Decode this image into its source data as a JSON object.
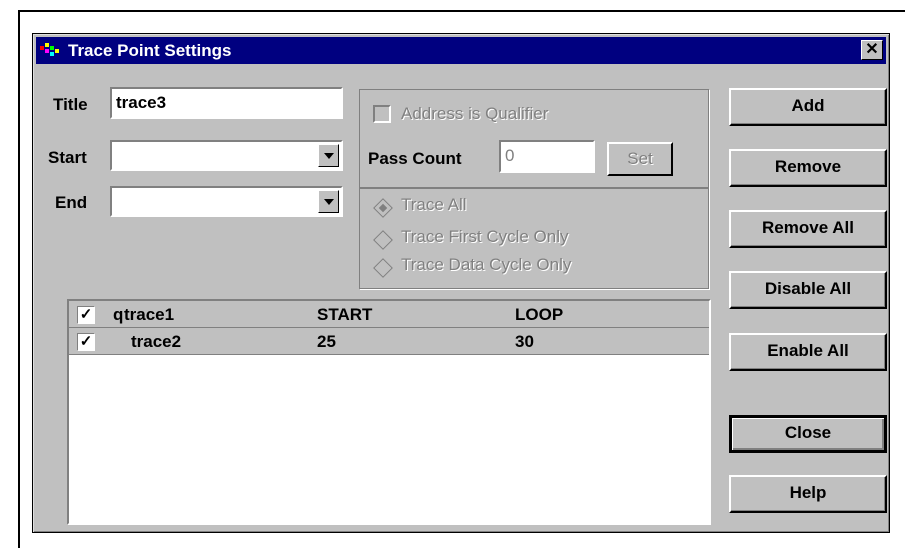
{
  "dialog": {
    "title": "Trace Point Settings",
    "close_label": "✕",
    "title_field": {
      "label": "Title",
      "value": "trace3"
    },
    "start_field": {
      "label": "Start",
      "value": ""
    },
    "end_field": {
      "label": "End",
      "value": ""
    },
    "qualifier": {
      "label": "Address is Qualifier",
      "checked": false,
      "enabled": false
    },
    "pass_count": {
      "label": "Pass Count",
      "value": "0",
      "set_label": "Set"
    },
    "trace_modes": [
      {
        "label": "Trace All",
        "selected": true
      },
      {
        "label": "Trace First Cycle Only",
        "selected": false
      },
      {
        "label": "Trace Data Cycle Only",
        "selected": false
      }
    ],
    "buttons": {
      "add": "Add",
      "remove": "Remove",
      "remove_all": "Remove All",
      "disable_all": "Disable All",
      "enable_all": "Enable All",
      "close": "Close",
      "help": "Help"
    },
    "trace_list": [
      {
        "checked": true,
        "marker": "q",
        "name": "trace1",
        "start": "START",
        "loop": "LOOP"
      },
      {
        "checked": true,
        "marker": "",
        "name": "trace2",
        "start": "25",
        "loop": "30"
      }
    ]
  }
}
